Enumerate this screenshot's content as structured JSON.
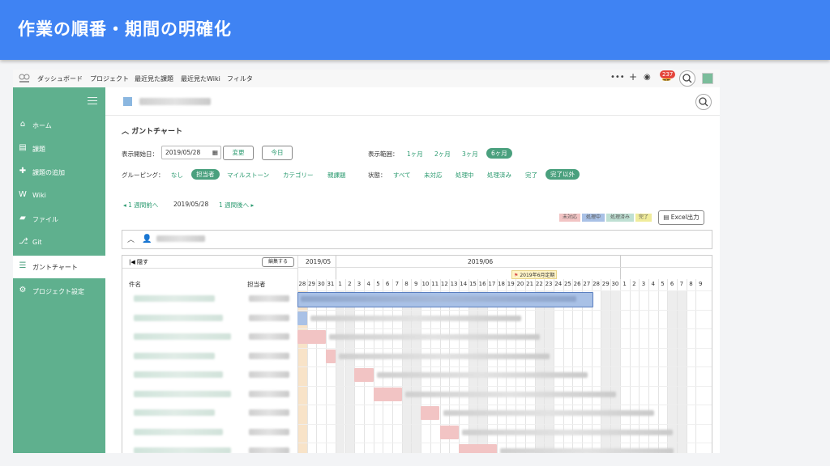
{
  "slide": {
    "title": "作業の順番・期間の明確化"
  },
  "topnav": {
    "items": [
      "ダッシュボード",
      "プロジェクト",
      "最近見た課題",
      "最近見たWiki",
      "フィルタ"
    ],
    "notification_count": "237"
  },
  "sidebar": {
    "items": [
      {
        "label": "ホーム",
        "icon": "home-icon"
      },
      {
        "label": "課題",
        "icon": "list-icon"
      },
      {
        "label": "課題の追加",
        "icon": "plus-icon"
      },
      {
        "label": "Wiki",
        "icon": "wiki-icon"
      },
      {
        "label": "ファイル",
        "icon": "folder-icon"
      },
      {
        "label": "Git",
        "icon": "git-icon"
      },
      {
        "label": "ガントチャート",
        "icon": "gantt-icon"
      },
      {
        "label": "プロジェクト設定",
        "icon": "gear-icon"
      }
    ],
    "active_index": 6
  },
  "gantt": {
    "section_title": "ガントチャート",
    "start_date_label": "表示開始日：",
    "start_date_value": "2019/05/28",
    "change_button": "変更",
    "today_button": "今日",
    "range_label": "表示範囲：",
    "range_options": [
      "1ヶ月",
      "2ヶ月",
      "3ヶ月",
      "6ヶ月"
    ],
    "range_selected": "6ヶ月",
    "grouping_label": "グルーピング：",
    "grouping_options": [
      "なし",
      "担当者",
      "マイルストーン",
      "カテゴリー",
      "親課題"
    ],
    "grouping_selected": "担当者",
    "status_label": "状態：",
    "status_options": [
      "すべて",
      "未対応",
      "処理中",
      "処理済み",
      "完了",
      "完了以外"
    ],
    "status_selected": "完了以外",
    "prev_week": "1 週間前へ",
    "current_date": "2019/05/28",
    "next_week": "1 週間後へ",
    "legend": [
      "未対応",
      "処理中",
      "処理済み",
      "完了"
    ],
    "excel_button": "Excel出力",
    "hide_label": "隠す",
    "edit_button": "編集する",
    "col_title": "件名",
    "col_assignee": "担当者",
    "month_may": "2019/05",
    "month_june": "2019/06",
    "milestone": "2019年6月定期",
    "days": [
      "28",
      "29",
      "30",
      "31",
      "1",
      "2",
      "3",
      "4",
      "5",
      "6",
      "7",
      "8",
      "9",
      "10",
      "11",
      "12",
      "13",
      "14",
      "15",
      "16",
      "17",
      "18",
      "19",
      "20",
      "21",
      "22",
      "23",
      "24",
      "25",
      "26",
      "27",
      "28",
      "29",
      "30",
      "1",
      "2",
      "3",
      "4",
      "5",
      "6",
      "7",
      "8",
      "9"
    ]
  },
  "colors": {
    "header": "#3f83f3",
    "sidebar": "#5fb08e",
    "accent": "#4aa07e",
    "todo": "#f2c4c4",
    "inprogress": "#a9c1e6"
  }
}
